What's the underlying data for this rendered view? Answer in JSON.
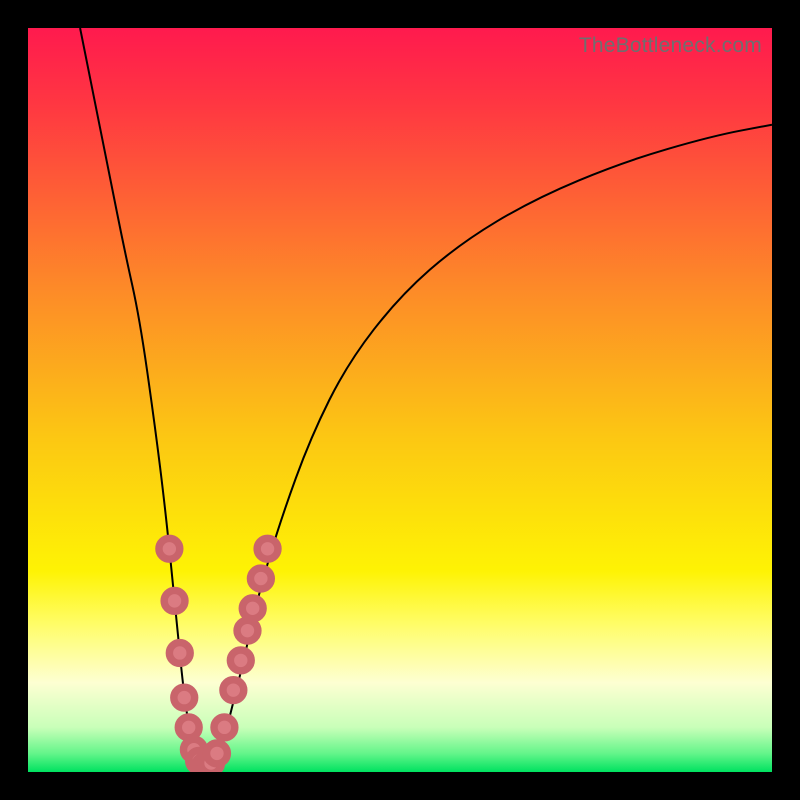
{
  "watermark": "TheBottleneck.com",
  "chart_data": {
    "type": "line",
    "title": "",
    "xlabel": "",
    "ylabel": "",
    "xlim": [
      0,
      100
    ],
    "ylim": [
      0,
      100
    ],
    "grid": false,
    "gradient_stops": [
      {
        "offset": 0.0,
        "color": "#ff1a4e"
      },
      {
        "offset": 0.1,
        "color": "#ff3642"
      },
      {
        "offset": 0.35,
        "color": "#fd8a28"
      },
      {
        "offset": 0.55,
        "color": "#fcc713"
      },
      {
        "offset": 0.73,
        "color": "#fef304"
      },
      {
        "offset": 0.8,
        "color": "#fffd66"
      },
      {
        "offset": 0.88,
        "color": "#fdffd2"
      },
      {
        "offset": 0.94,
        "color": "#c9ffb9"
      },
      {
        "offset": 0.975,
        "color": "#64f58a"
      },
      {
        "offset": 1.0,
        "color": "#00e260"
      }
    ],
    "series": [
      {
        "name": "bottleneck-curve",
        "x": [
          7,
          9,
          11,
          13,
          15,
          17,
          18.5,
          20,
          21,
          22,
          23,
          24,
          25,
          26,
          27,
          29,
          31,
          34,
          38,
          43,
          50,
          58,
          68,
          80,
          92,
          100
        ],
        "y": [
          100,
          90,
          80,
          70,
          61,
          47,
          35,
          20,
          10,
          4,
          1,
          0.5,
          1,
          3,
          7,
          15,
          24,
          34,
          45,
          55,
          64,
          71,
          77,
          82,
          85.5,
          87
        ]
      }
    ],
    "markers": {
      "name": "datapoints",
      "points": [
        {
          "x": 19.0,
          "y": 30
        },
        {
          "x": 19.7,
          "y": 23
        },
        {
          "x": 20.4,
          "y": 16
        },
        {
          "x": 21.0,
          "y": 10
        },
        {
          "x": 21.6,
          "y": 6
        },
        {
          "x": 22.3,
          "y": 3
        },
        {
          "x": 23.0,
          "y": 1.5
        },
        {
          "x": 23.8,
          "y": 0.8
        },
        {
          "x": 24.6,
          "y": 1.2
        },
        {
          "x": 25.4,
          "y": 2.5
        },
        {
          "x": 26.4,
          "y": 6
        },
        {
          "x": 27.6,
          "y": 11
        },
        {
          "x": 28.6,
          "y": 15
        },
        {
          "x": 29.5,
          "y": 19
        },
        {
          "x": 30.2,
          "y": 22
        },
        {
          "x": 31.3,
          "y": 26
        },
        {
          "x": 32.2,
          "y": 30
        }
      ]
    }
  }
}
